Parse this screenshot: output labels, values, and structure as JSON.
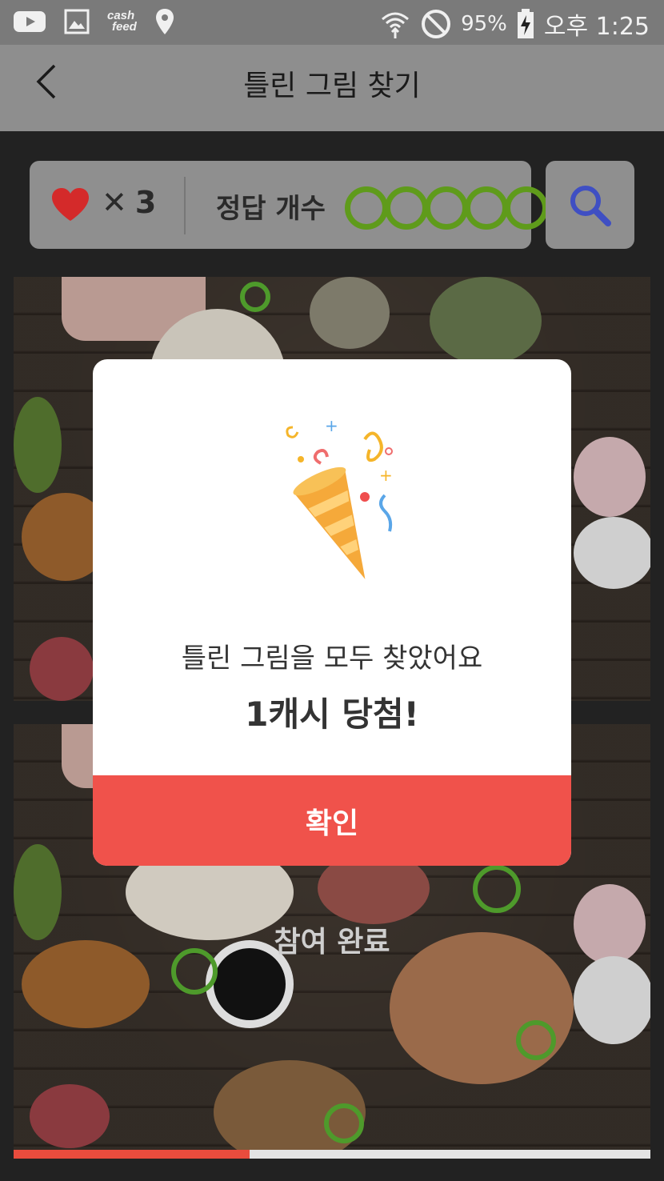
{
  "status_bar": {
    "cashfeed_top": "cash",
    "cashfeed_bottom": "feed",
    "battery": "95%",
    "time": "오후 1:25"
  },
  "header": {
    "title": "틀린 그림 찾기"
  },
  "game_status": {
    "lives_symbol": "✕",
    "lives_count": "3",
    "answer_label": "정답 개수",
    "answers_total": 5,
    "answers_found": 5
  },
  "photo_overlay": {
    "done_label": "참여 완료"
  },
  "progress": {
    "fraction": 0.37
  },
  "modal": {
    "message": "틀린 그림을 모두 찾았어요",
    "prize": "1캐시 당첨!",
    "confirm_label": "확인"
  },
  "colors": {
    "accent_red": "#f0524b",
    "answer_green": "#5f9b1b",
    "search_blue": "#3f4fc3"
  }
}
